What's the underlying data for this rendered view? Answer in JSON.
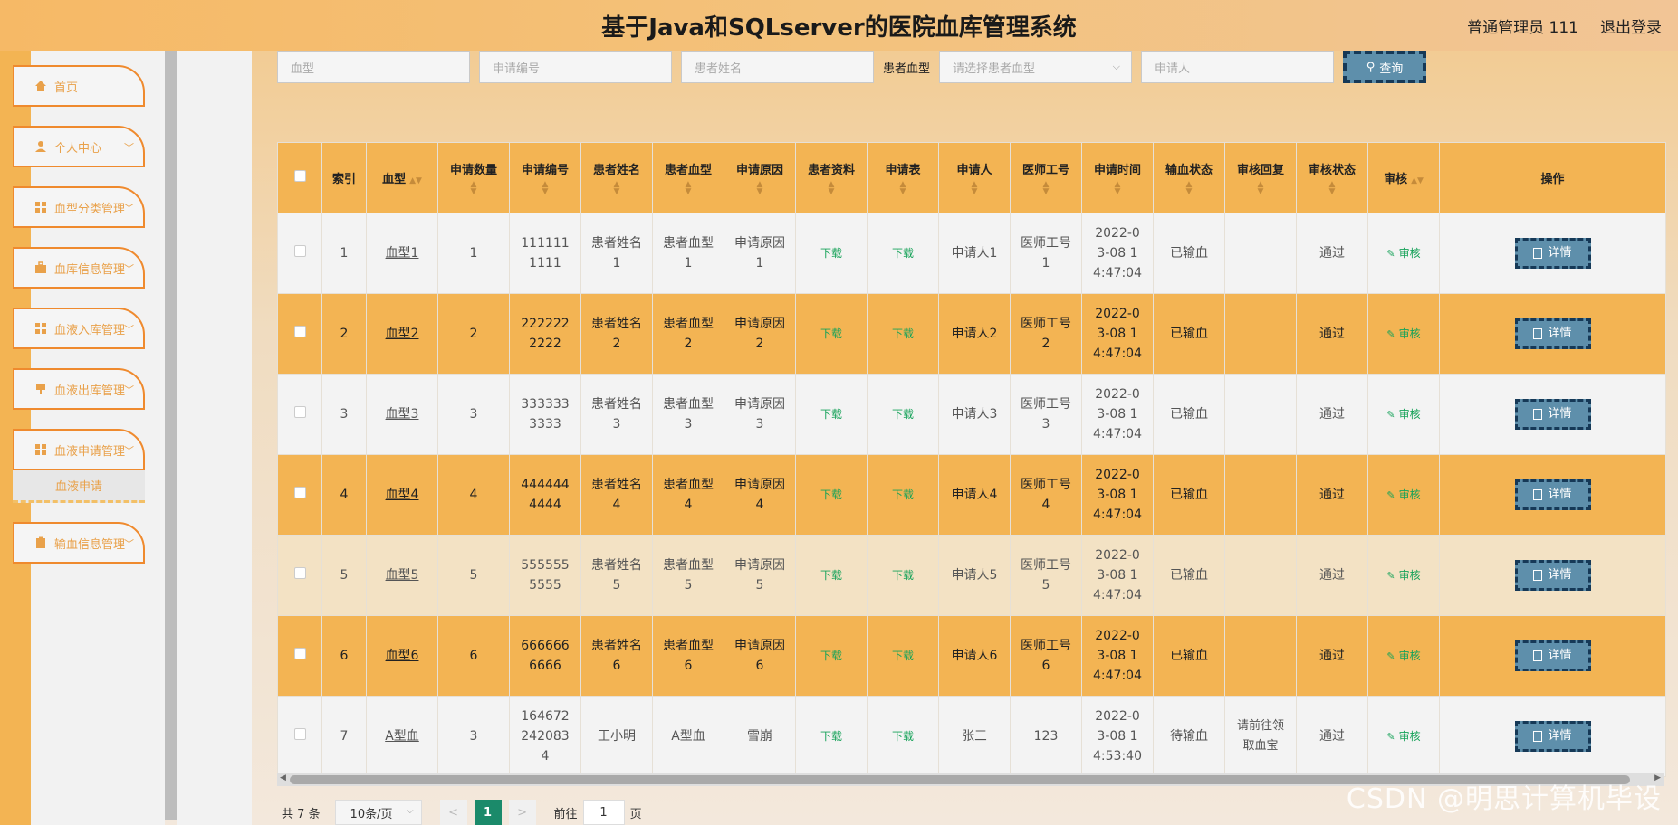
{
  "header": {
    "title": "基于Java和SQLserver的医院血库管理系统",
    "user": "普通管理员 111",
    "logout": "退出登录"
  },
  "sidebar": {
    "items": [
      {
        "label": "首页",
        "icon": "home-icon"
      },
      {
        "label": "个人中心",
        "icon": "user-icon",
        "chevron": "﹀"
      },
      {
        "label": "血型分类管理",
        "icon": "grid-icon",
        "chevron": "﹀"
      },
      {
        "label": "血库信息管理",
        "icon": "briefcase-icon",
        "chevron": "﹀"
      },
      {
        "label": "血液入库管理",
        "icon": "grid-icon",
        "chevron": "﹀"
      },
      {
        "label": "血液出库管理",
        "icon": "flag-icon",
        "chevron": "﹀"
      },
      {
        "label": "血液申请管理",
        "icon": "grid-icon",
        "chevron": "﹀"
      },
      {
        "label": "输血信息管理",
        "icon": "clipboard-icon",
        "chevron": "﹀"
      }
    ],
    "submenu_label": "血液申请"
  },
  "search": {
    "blood_type_placeholder": "血型",
    "apply_no_placeholder": "申请编号",
    "patient_name_placeholder": "患者姓名",
    "patient_blood_label": "患者血型",
    "patient_blood_placeholder": "请选择患者血型",
    "applicant_placeholder": "申请人",
    "query_label": "查询"
  },
  "table": {
    "headers": {
      "index": "索引",
      "blood_type": "血型",
      "quantity": "申请数量",
      "apply_no": "申请编号",
      "patient_name": "患者姓名",
      "patient_blood": "患者血型",
      "reason": "申请原因",
      "patient_info": "患者资料",
      "form": "申请表",
      "applicant": "申请人",
      "doctor_no": "医师工号",
      "apply_time": "申请时间",
      "transfusion_status": "输血状态",
      "audit_reply": "审核回复",
      "audit_status": "审核状态",
      "audit": "审核",
      "action": "操作"
    },
    "rows": [
      {
        "index": "1",
        "blood_type": "血型1",
        "quantity": "1",
        "apply_no": "1111111111",
        "patient_name": "患者姓名1",
        "patient_blood": "患者血型1",
        "reason": "申请原因1",
        "patient_info": "下载",
        "form": "下载",
        "applicant": "申请人1",
        "doctor_no": "医师工号1",
        "apply_time": "2022-03-08 14:47:04",
        "transfusion_status": "已输血",
        "audit_reply": "",
        "audit_status": "通过",
        "audit": "审核",
        "detail": "详情"
      },
      {
        "index": "2",
        "blood_type": "血型2",
        "quantity": "2",
        "apply_no": "2222222222",
        "patient_name": "患者姓名2",
        "patient_blood": "患者血型2",
        "reason": "申请原因2",
        "patient_info": "下载",
        "form": "下载",
        "applicant": "申请人2",
        "doctor_no": "医师工号2",
        "apply_time": "2022-03-08 14:47:04",
        "transfusion_status": "已输血",
        "audit_reply": "",
        "audit_status": "通过",
        "audit": "审核",
        "detail": "详情"
      },
      {
        "index": "3",
        "blood_type": "血型3",
        "quantity": "3",
        "apply_no": "3333333333",
        "patient_name": "患者姓名3",
        "patient_blood": "患者血型3",
        "reason": "申请原因3",
        "patient_info": "下载",
        "form": "下载",
        "applicant": "申请人3",
        "doctor_no": "医师工号3",
        "apply_time": "2022-03-08 14:47:04",
        "transfusion_status": "已输血",
        "audit_reply": "",
        "audit_status": "通过",
        "audit": "审核",
        "detail": "详情"
      },
      {
        "index": "4",
        "blood_type": "血型4",
        "quantity": "4",
        "apply_no": "4444444444",
        "patient_name": "患者姓名4",
        "patient_blood": "患者血型4",
        "reason": "申请原因4",
        "patient_info": "下载",
        "form": "下载",
        "applicant": "申请人4",
        "doctor_no": "医师工号4",
        "apply_time": "2022-03-08 14:47:04",
        "transfusion_status": "已输血",
        "audit_reply": "",
        "audit_status": "通过",
        "audit": "审核",
        "detail": "详情"
      },
      {
        "index": "5",
        "blood_type": "血型5",
        "quantity": "5",
        "apply_no": "5555555555",
        "patient_name": "患者姓名5",
        "patient_blood": "患者血型5",
        "reason": "申请原因5",
        "patient_info": "下载",
        "form": "下载",
        "applicant": "申请人5",
        "doctor_no": "医师工号5",
        "apply_time": "2022-03-08 14:47:04",
        "transfusion_status": "已输血",
        "audit_reply": "",
        "audit_status": "通过",
        "audit": "审核",
        "detail": "详情"
      },
      {
        "index": "6",
        "blood_type": "血型6",
        "quantity": "6",
        "apply_no": "6666666666",
        "patient_name": "患者姓名6",
        "patient_blood": "患者血型6",
        "reason": "申请原因6",
        "patient_info": "下载",
        "form": "下载",
        "applicant": "申请人6",
        "doctor_no": "医师工号6",
        "apply_time": "2022-03-08 14:47:04",
        "transfusion_status": "已输血",
        "audit_reply": "",
        "audit_status": "通过",
        "audit": "审核",
        "detail": "详情"
      },
      {
        "index": "7",
        "blood_type": "A型血",
        "quantity": "3",
        "apply_no": "1646722420834",
        "patient_name": "王小明",
        "patient_blood": "A型血",
        "reason": "雪崩",
        "patient_info": "下载",
        "form": "下载",
        "applicant": "张三",
        "doctor_no": "123",
        "apply_time": "2022-03-08 14:53:40",
        "transfusion_status": "待输血",
        "audit_reply": "请前往领取血宝",
        "audit_status": "通过",
        "audit": "审核",
        "detail": "详情"
      }
    ]
  },
  "pager": {
    "total": "共 7 条",
    "page_size": "10条/页",
    "prev": "<",
    "current": "1",
    "next": ">",
    "goto_label": "前往",
    "goto_value": "1",
    "page_unit": "页"
  },
  "watermark": "CSDN @明思计算机毕设",
  "colors": {
    "accent": "#f3b453",
    "button": "#5e8fab",
    "link": "#18a35a",
    "menu_border": "#ef8a2e"
  }
}
